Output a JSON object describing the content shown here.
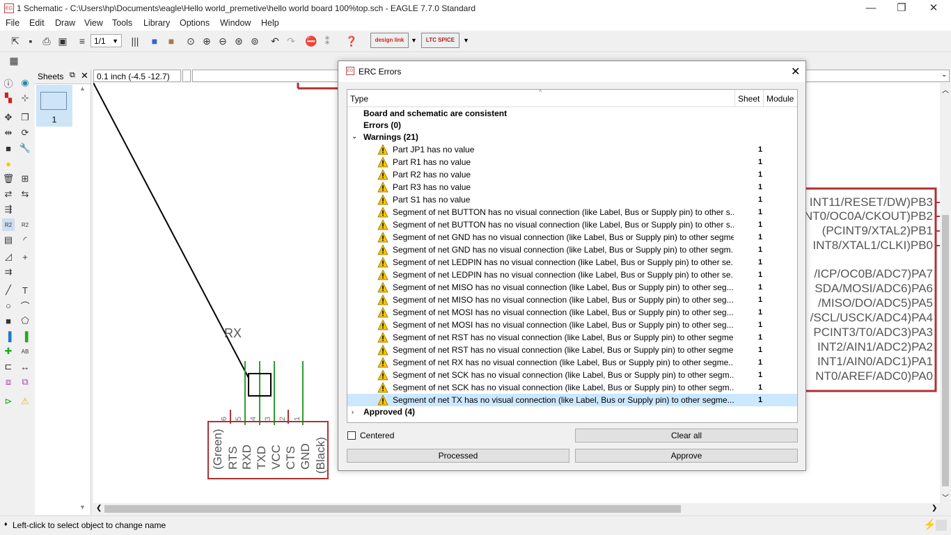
{
  "window": {
    "title": "1 Schematic - C:\\Users\\hp\\Documents\\eagle\\Hello world_premetive\\hello world board 100%top.sch - EAGLE 7.7.0 Standard",
    "minimize": "—",
    "restore": "❐",
    "close": "✕"
  },
  "menu": [
    "File",
    "Edit",
    "Draw",
    "View",
    "Tools",
    "Library",
    "Options",
    "Window",
    "Help"
  ],
  "toolbar": {
    "zoom_value": "1/1",
    "designlink_label": "design link",
    "ltspice_label": "LTC SPICE"
  },
  "sheets": {
    "header": "Sheets",
    "sheet_number": "1"
  },
  "coordinates": "0.1 inch (-4.5 -12.7)",
  "schematic": {
    "rx_label": "RX",
    "connector_pins": [
      "(Green)",
      "RTS",
      "RXD",
      "TXD",
      "VCC",
      "CTS",
      "GND",
      "(Black)"
    ],
    "pin_numbers": [
      "6",
      "5",
      "4",
      "3",
      "2",
      "1"
    ],
    "mcu_pins": [
      "INT11/RESET/DW)PB3",
      "INT0/OC0A/CKOUT)PB2",
      "(PCINT9/XTAL2)PB1",
      "INT8/XTAL1/CLKI)PB0",
      "",
      "/ICP/OC0B/ADC7)PA7",
      "SDA/MOSI/ADC6)PA6",
      "/MISO/DO/ADC5)PA5",
      "/SCL/USCK/ADC4)PA4",
      "PCINT3/T0/ADC3)PA3",
      "INT2/AIN1/ADC2)PA2",
      "INT1/AIN0/ADC1)PA1",
      "NT0/AREF/ADC0)PA0"
    ]
  },
  "dialog": {
    "title": "ERC Errors",
    "columns": {
      "type": "Type",
      "sheet": "Sheet",
      "module": "Module"
    },
    "consistent": "Board and schematic are consistent",
    "errors": "Errors (0)",
    "warnings": "Warnings (21)",
    "approved": "Approved (4)",
    "items": [
      {
        "text": "Part JP1 has no value",
        "sheet": "1"
      },
      {
        "text": "Part R1 has no value",
        "sheet": "1"
      },
      {
        "text": "Part R2 has no value",
        "sheet": "1"
      },
      {
        "text": "Part R3 has no value",
        "sheet": "1"
      },
      {
        "text": "Part S1 has no value",
        "sheet": "1"
      },
      {
        "text": "Segment of net BUTTON has no visual connection (like Label, Bus or Supply pin) to other s...",
        "sheet": "1"
      },
      {
        "text": "Segment of net BUTTON has no visual connection (like Label, Bus or Supply pin) to other s...",
        "sheet": "1"
      },
      {
        "text": "Segment of net GND has no visual connection (like Label, Bus or Supply pin) to other segme...",
        "sheet": "1"
      },
      {
        "text": "Segment of net GND has no visual connection (like Label, Bus or Supply pin) to other segm...",
        "sheet": "1"
      },
      {
        "text": "Segment of net LEDPIN has no visual connection (like Label, Bus or Supply pin) to other se...",
        "sheet": "1"
      },
      {
        "text": "Segment of net LEDPIN has no visual connection (like Label, Bus or Supply pin) to other se...",
        "sheet": "1"
      },
      {
        "text": "Segment of net MISO has no visual connection (like Label, Bus or Supply pin) to other seg...",
        "sheet": "1"
      },
      {
        "text": "Segment of net MISO has no visual connection (like Label, Bus or Supply pin) to other seg...",
        "sheet": "1"
      },
      {
        "text": "Segment of net MOSI has no visual connection (like Label, Bus or Supply pin) to other seg...",
        "sheet": "1"
      },
      {
        "text": "Segment of net MOSI has no visual connection (like Label, Bus or Supply pin) to other seg...",
        "sheet": "1"
      },
      {
        "text": "Segment of net RST has no visual connection (like Label, Bus or Supply pin) to other segme...",
        "sheet": "1"
      },
      {
        "text": "Segment of net RST has no visual connection (like Label, Bus or Supply pin) to other segme...",
        "sheet": "1"
      },
      {
        "text": "Segment of net RX has no visual connection (like Label, Bus or Supply pin) to other segme...",
        "sheet": "1"
      },
      {
        "text": "Segment of net SCK has no visual connection (like Label, Bus or Supply pin) to other segm...",
        "sheet": "1"
      },
      {
        "text": "Segment of net SCK has no visual connection (like Label, Bus or Supply pin) to other segm...",
        "sheet": "1"
      },
      {
        "text": "Segment of net TX has no visual connection (like Label, Bus or Supply pin) to other segme...",
        "sheet": "1"
      }
    ],
    "centered_label": "Centered",
    "clear_all": "Clear all",
    "processed": "Processed",
    "approve": "Approve"
  },
  "status": "Left-click to select object to change name",
  "colors": {
    "net_green": "#2e9e2e",
    "frame_red": "#b03030",
    "selection": "#cce8ff",
    "warning": "#f5c400"
  }
}
